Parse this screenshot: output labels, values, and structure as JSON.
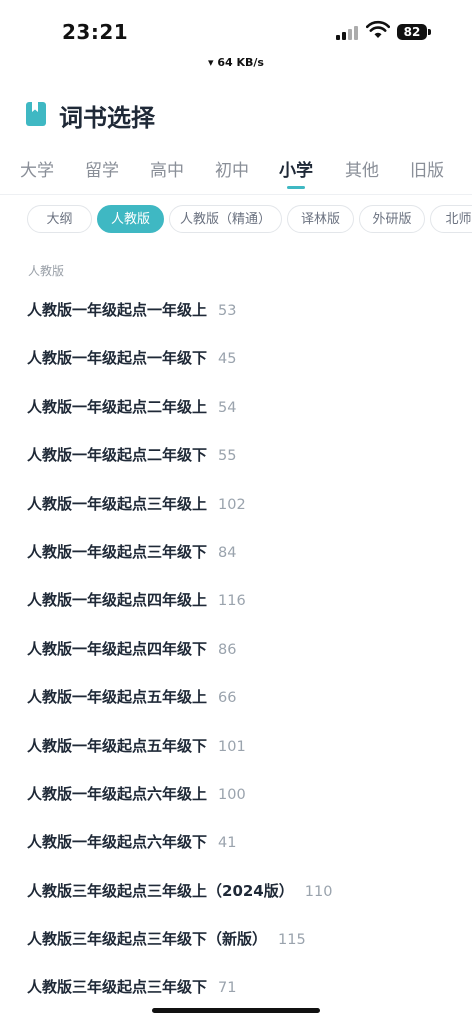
{
  "status": {
    "time": "23:21",
    "battery": "82",
    "net_speed": "▾ 64 KB/s"
  },
  "header": {
    "title": "词书选择"
  },
  "grade_tabs": [
    {
      "label": "大学",
      "active": false
    },
    {
      "label": "留学",
      "active": false
    },
    {
      "label": "高中",
      "active": false
    },
    {
      "label": "初中",
      "active": false
    },
    {
      "label": "小学",
      "active": true
    },
    {
      "label": "其他",
      "active": false
    },
    {
      "label": "旧版",
      "active": false
    }
  ],
  "edition_chips": [
    {
      "label": "大纲",
      "active": false
    },
    {
      "label": "人教版",
      "active": true
    },
    {
      "label": "人教版（精通）",
      "active": false
    },
    {
      "label": "译林版",
      "active": false
    },
    {
      "label": "外研版",
      "active": false
    },
    {
      "label": "北师大",
      "active": false
    }
  ],
  "section_label": "人教版",
  "books": [
    {
      "name": "人教版一年级起点一年级上",
      "count": "53"
    },
    {
      "name": "人教版一年级起点一年级下",
      "count": "45"
    },
    {
      "name": "人教版一年级起点二年级上",
      "count": "54"
    },
    {
      "name": "人教版一年级起点二年级下",
      "count": "55"
    },
    {
      "name": "人教版一年级起点三年级上",
      "count": "102"
    },
    {
      "name": "人教版一年级起点三年级下",
      "count": "84"
    },
    {
      "name": "人教版一年级起点四年级上",
      "count": "116"
    },
    {
      "name": "人教版一年级起点四年级下",
      "count": "86"
    },
    {
      "name": "人教版一年级起点五年级上",
      "count": "66"
    },
    {
      "name": "人教版一年级起点五年级下",
      "count": "101"
    },
    {
      "name": "人教版一年级起点六年级上",
      "count": "100"
    },
    {
      "name": "人教版一年级起点六年级下",
      "count": "41"
    },
    {
      "name": "人教版三年级起点三年级上（2024版）",
      "count": "110"
    },
    {
      "name": "人教版三年级起点三年级下（新版）",
      "count": "115"
    },
    {
      "name": "人教版三年级起点三年级下",
      "count": "71"
    }
  ],
  "colors": {
    "accent": "#3fb8c3",
    "text_primary": "#1f2937",
    "text_muted": "#9aa3ad"
  }
}
